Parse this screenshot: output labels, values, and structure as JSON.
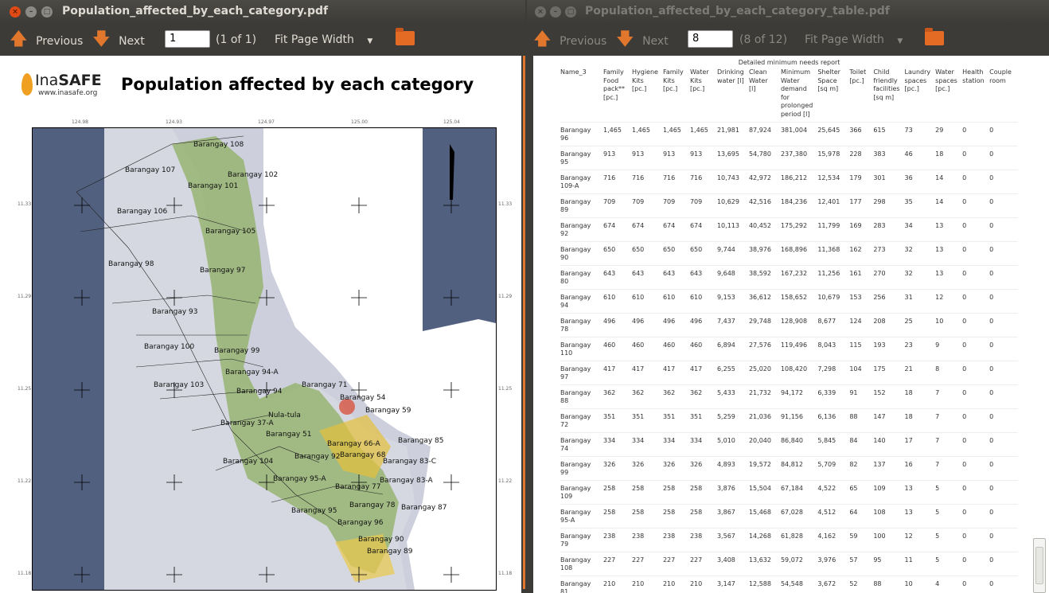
{
  "left_window": {
    "title": "Population_affected_by_each_category.pdf",
    "toolbar": {
      "previous": "Previous",
      "next": "Next",
      "page_value": "1",
      "page_count": "(1 of 1)",
      "zoom": "Fit Page Width"
    },
    "page": {
      "logo_text_light": "Ina",
      "logo_text_bold": "SAFE",
      "logo_url": "www.inasafe.org",
      "heading": "Population affected by each category",
      "map_coords_top": [
        "124.98",
        "124.93",
        "124.97",
        "125.00",
        "125.04"
      ],
      "map_coords_side": [
        "11.33",
        "11.29",
        "11.25",
        "11.22",
        "11.18"
      ],
      "map_labels": [
        "Barangay 108",
        "Barangay 107",
        "Barangay 102",
        "Barangay 101",
        "Barangay 106",
        "Barangay 105",
        "Barangay 98",
        "Barangay 97",
        "Barangay 93",
        "Barangay 100",
        "Barangay 99",
        "Barangay 94-A",
        "Barangay 103",
        "Barangay 94",
        "Barangay 71",
        "Barangay 54",
        "Barangay 59",
        "Nula-tula",
        "Barangay 37-A",
        "Barangay 51",
        "Barangay 66-A",
        "Barangay 85",
        "Barangay 92",
        "Barangay 68",
        "Barangay 83-C",
        "Barangay 104",
        "Barangay 95-A",
        "Barangay 77",
        "Barangay 83-A",
        "Barangay 95",
        "Barangay 78",
        "Barangay 87",
        "Barangay 96",
        "Barangay 90",
        "Barangay 89"
      ]
    }
  },
  "right_window": {
    "title": "Population_affected_by_each_category_table.pdf",
    "toolbar": {
      "previous": "Previous",
      "next": "Next",
      "page_value": "8",
      "page_count": "(8 of 12)",
      "zoom": "Fit Page Width"
    },
    "table": {
      "caption": "Detailed minimum needs report",
      "columns": [
        "Name_3",
        "Family Food pack** [pc.]",
        "Hygiene Kits [pc.]",
        "Family Kits [pc.]",
        "Water Kits [pc.]",
        "Drinking water [l]",
        "Clean Water [l]",
        "Minimum Water demand for prolonged period [l]",
        "Shelter Space [sq m]",
        "Toilet [pc.]",
        "Child friendly facilities [sq m]",
        "Laundry spaces [pc.]",
        "Water spaces [pc.]",
        "Health station",
        "Couple room"
      ],
      "rows": [
        [
          "Barangay 96",
          "1,465",
          "1,465",
          "1,465",
          "1,465",
          "21,981",
          "87,924",
          "381,004",
          "25,645",
          "366",
          "615",
          "73",
          "29",
          "0",
          "0"
        ],
        [
          "Barangay 95",
          "913",
          "913",
          "913",
          "913",
          "13,695",
          "54,780",
          "237,380",
          "15,978",
          "228",
          "383",
          "46",
          "18",
          "0",
          "0"
        ],
        [
          "Barangay 109-A",
          "716",
          "716",
          "716",
          "716",
          "10,743",
          "42,972",
          "186,212",
          "12,534",
          "179",
          "301",
          "36",
          "14",
          "0",
          "0"
        ],
        [
          "Barangay 89",
          "709",
          "709",
          "709",
          "709",
          "10,629",
          "42,516",
          "184,236",
          "12,401",
          "177",
          "298",
          "35",
          "14",
          "0",
          "0"
        ],
        [
          "Barangay 92",
          "674",
          "674",
          "674",
          "674",
          "10,113",
          "40,452",
          "175,292",
          "11,799",
          "169",
          "283",
          "34",
          "13",
          "0",
          "0"
        ],
        [
          "Barangay 90",
          "650",
          "650",
          "650",
          "650",
          "9,744",
          "38,976",
          "168,896",
          "11,368",
          "162",
          "273",
          "32",
          "13",
          "0",
          "0"
        ],
        [
          "Barangay 80",
          "643",
          "643",
          "643",
          "643",
          "9,648",
          "38,592",
          "167,232",
          "11,256",
          "161",
          "270",
          "32",
          "13",
          "0",
          "0"
        ],
        [
          "Barangay 94",
          "610",
          "610",
          "610",
          "610",
          "9,153",
          "36,612",
          "158,652",
          "10,679",
          "153",
          "256",
          "31",
          "12",
          "0",
          "0"
        ],
        [
          "Barangay 78",
          "496",
          "496",
          "496",
          "496",
          "7,437",
          "29,748",
          "128,908",
          "8,677",
          "124",
          "208",
          "25",
          "10",
          "0",
          "0"
        ],
        [
          "Barangay 110",
          "460",
          "460",
          "460",
          "460",
          "6,894",
          "27,576",
          "119,496",
          "8,043",
          "115",
          "193",
          "23",
          "9",
          "0",
          "0"
        ],
        [
          "Barangay 97",
          "417",
          "417",
          "417",
          "417",
          "6,255",
          "25,020",
          "108,420",
          "7,298",
          "104",
          "175",
          "21",
          "8",
          "0",
          "0"
        ],
        [
          "Barangay 88",
          "362",
          "362",
          "362",
          "362",
          "5,433",
          "21,732",
          "94,172",
          "6,339",
          "91",
          "152",
          "18",
          "7",
          "0",
          "0"
        ],
        [
          "Barangay 72",
          "351",
          "351",
          "351",
          "351",
          "5,259",
          "21,036",
          "91,156",
          "6,136",
          "88",
          "147",
          "18",
          "7",
          "0",
          "0"
        ],
        [
          "Barangay 74",
          "334",
          "334",
          "334",
          "334",
          "5,010",
          "20,040",
          "86,840",
          "5,845",
          "84",
          "140",
          "17",
          "7",
          "0",
          "0"
        ],
        [
          "Barangay 99",
          "326",
          "326",
          "326",
          "326",
          "4,893",
          "19,572",
          "84,812",
          "5,709",
          "82",
          "137",
          "16",
          "7",
          "0",
          "0"
        ],
        [
          "Barangay 109",
          "258",
          "258",
          "258",
          "258",
          "3,876",
          "15,504",
          "67,184",
          "4,522",
          "65",
          "109",
          "13",
          "5",
          "0",
          "0"
        ],
        [
          "Barangay 95-A",
          "258",
          "258",
          "258",
          "258",
          "3,867",
          "15,468",
          "67,028",
          "4,512",
          "64",
          "108",
          "13",
          "5",
          "0",
          "0"
        ],
        [
          "Barangay 79",
          "238",
          "238",
          "238",
          "238",
          "3,567",
          "14,268",
          "61,828",
          "4,162",
          "59",
          "100",
          "12",
          "5",
          "0",
          "0"
        ],
        [
          "Barangay 108",
          "227",
          "227",
          "227",
          "227",
          "3,408",
          "13,632",
          "59,072",
          "3,976",
          "57",
          "95",
          "11",
          "5",
          "0",
          "0"
        ],
        [
          "Barangay 81",
          "210",
          "210",
          "210",
          "210",
          "3,147",
          "12,588",
          "54,548",
          "3,672",
          "52",
          "88",
          "10",
          "4",
          "0",
          "0"
        ]
      ]
    }
  },
  "colors": {
    "accent": "#e0772c",
    "chrome": "#3c3b37",
    "close": "#df4a16",
    "map_sea": "#52607f",
    "map_land": "#cdd0dc"
  }
}
